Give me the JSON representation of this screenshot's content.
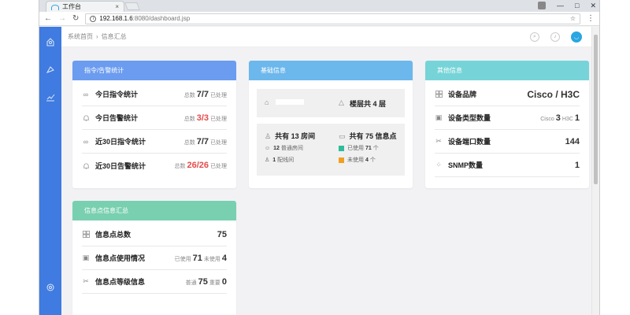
{
  "browser": {
    "tab_title": "工作台",
    "tab_close": "×",
    "url_host": "192.168.1.6",
    "url_path": ":8080/dashboard.jsp",
    "window_controls": [
      "—",
      "□",
      "✕"
    ]
  },
  "breadcrumb": {
    "home": "系统首页",
    "sep": "›",
    "current": "信息汇总"
  },
  "cards": {
    "cmd": {
      "title": "指令/告警统计",
      "color": "#6b9cf0",
      "rows": [
        {
          "label": "今日指令统计",
          "total_label": "总数",
          "total": "7/7",
          "suffix": "已处理",
          "red": false
        },
        {
          "label": "今日告警统计",
          "total_label": "总数",
          "total": "3/3",
          "suffix": "已处理",
          "red": true
        },
        {
          "label": "近30日指令统计",
          "total_label": "总数",
          "total": "7/7",
          "suffix": "已处理",
          "red": false
        },
        {
          "label": "近30日告警统计",
          "total_label": "总数",
          "total": "26/26",
          "suffix": "已处理",
          "red": true
        }
      ]
    },
    "base": {
      "title": "基础信息",
      "color": "#6cb7ec",
      "floors": "楼层共 4 层",
      "rooms_total": "共有 13 房间",
      "rooms_normal_num": "12",
      "rooms_normal_label": "普通房间",
      "rooms_dist_num": "1",
      "rooms_dist_label": "配线间",
      "points_total": "共有 75 信息点",
      "used_label": "已使用",
      "used_num": "71",
      "unused_label": "未使用",
      "unused_num": "4",
      "unit": "个",
      "used_color": "#2ebc9a",
      "unused_color": "#f0a020"
    },
    "other": {
      "title": "其他信息",
      "color": "#76d4d8",
      "brand_label": "设备品牌",
      "brand_value": "Cisco / H3C",
      "type_label": "设备类型数量",
      "type_cisco": "Cisco",
      "type_cisco_num": "3",
      "type_h3c": "H3C",
      "type_h3c_num": "1",
      "ports_label": "设备端口数量",
      "ports_value": "144",
      "snmp_label": "SNMP数量",
      "snmp_value": "1"
    },
    "points": {
      "title": "信息点信息汇总",
      "color": "#79d0b0",
      "total_label": "信息点总数",
      "total_value": "75",
      "usage_label": "信息点使用情况",
      "used_label": "已使用",
      "used_num": "71",
      "unused_label": "未使用",
      "unused_num": "4",
      "level_label": "信息点等级信息",
      "normal_label": "普通",
      "normal_num": "75",
      "important_label": "重要",
      "important_num": "0"
    }
  }
}
